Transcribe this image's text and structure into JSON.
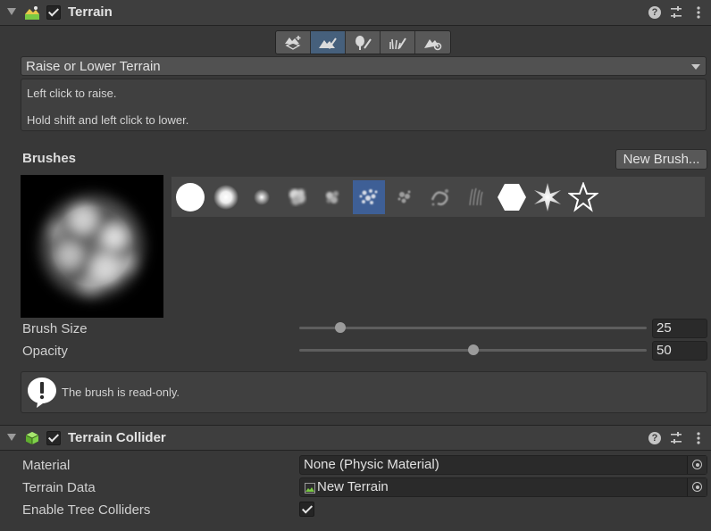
{
  "terrain": {
    "title": "Terrain",
    "enabled": true,
    "tool_mode": "Raise or Lower Terrain",
    "description_line1": "Left click to raise.",
    "description_line2": "Hold shift and left click to lower.",
    "toolbar": [
      {
        "icon": "create-neighbor-terrains-icon",
        "active": false
      },
      {
        "icon": "paint-terrain-icon",
        "active": true
      },
      {
        "icon": "paint-trees-icon",
        "active": false
      },
      {
        "icon": "paint-details-icon",
        "active": false
      },
      {
        "icon": "terrain-settings-icon",
        "active": false
      }
    ],
    "brushes_label": "Brushes",
    "new_brush_label": "New Brush...",
    "brush_icons": [
      "brush-hard-circle-icon",
      "brush-soft-circle-icon",
      "brush-small-soft-icon",
      "brush-cloud-icon",
      "brush-noise-icon",
      "brush-scatter-icon",
      "brush-splatter-icon",
      "brush-ring-icon",
      "brush-grass-icon",
      "brush-hexagon-icon",
      "brush-starburst-icon",
      "brush-star-outline-icon"
    ],
    "selected_brush_index": 5,
    "brush_size_label": "Brush Size",
    "brush_size_value": "25",
    "brush_size_fraction": 0.118,
    "opacity_label": "Opacity",
    "opacity_value": "50",
    "opacity_fraction": 0.5,
    "info_message": "The brush is read-only."
  },
  "collider": {
    "title": "Terrain Collider",
    "enabled": true,
    "material_label": "Material",
    "material_value": "None (Physic Material)",
    "terrain_data_label": "Terrain Data",
    "terrain_data_value": "New Terrain",
    "tree_colliders_label": "Enable Tree Colliders",
    "tree_colliders_checked": true
  },
  "colors": {
    "selected_tool": "#46607c",
    "selected_brush": "#3e5f96",
    "terrain_icon_green": "#7ac943"
  }
}
